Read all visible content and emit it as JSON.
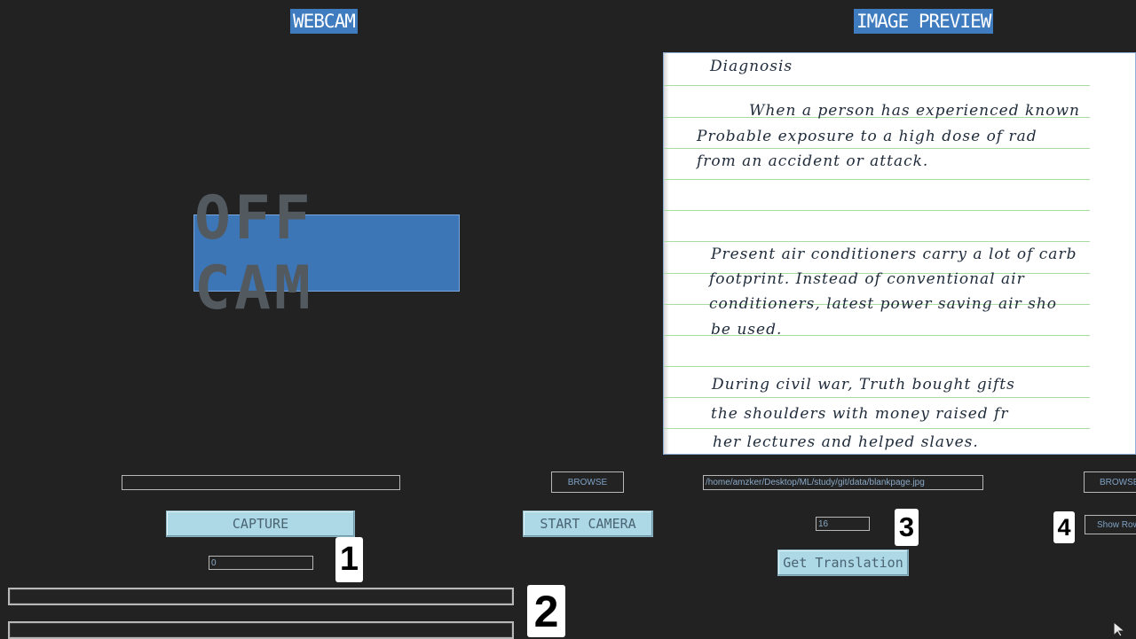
{
  "webcam": {
    "title": "WEBCAM",
    "off_cam_label": "OFF CAM",
    "path_field_value": "",
    "browse_label": "BROWSE",
    "capture_label": "CAPTURE",
    "start_camera_label": "START CAMERA",
    "counter_value": "0",
    "marker_1": "1",
    "marker_2": "2"
  },
  "preview": {
    "title": "IMAGE PREVIEW",
    "lines": [
      "Diagnosis",
      "When a person has experienced known",
      "Probable exposure to a high dose of rad",
      "from an accident or attack.",
      "Present air conditioners carry a lot of carb",
      "footprint. Instead of conventional air",
      "conditioners, latest power saving air sho",
      "be used.",
      "During civil war, Truth bought gifts",
      "the shoulders with money raised fr",
      "her lectures and helped slaves."
    ],
    "file_path": "/home/amzker/Desktop/ML/study/git/data/blankpage.jpg",
    "browse_label": "BROWSE",
    "rows_value": "16",
    "marker_3": "3",
    "marker_4": "4",
    "show_rows_label": "Show Rows",
    "get_translation_label": "Get Translation"
  },
  "icons": {
    "cursor": "mouse-pointer-icon"
  },
  "colors": {
    "background": "#222222",
    "accent_blue": "#3f7bbf",
    "light_button": "#add8e6"
  }
}
